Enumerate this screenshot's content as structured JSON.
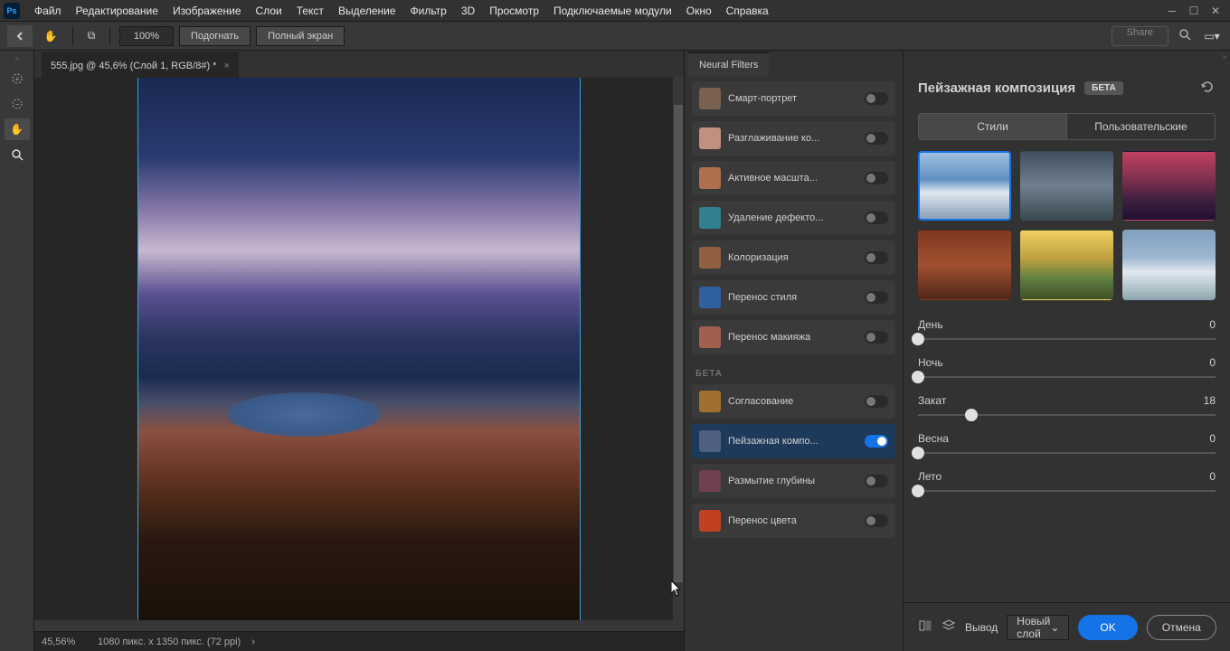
{
  "app": {
    "logo": "Ps"
  },
  "menu": {
    "items": [
      "Файл",
      "Редактирование",
      "Изображение",
      "Слои",
      "Текст",
      "Выделение",
      "Фильтр",
      "3D",
      "Просмотр",
      "Подключаемые модули",
      "Окно",
      "Справка"
    ]
  },
  "toolbar": {
    "zoom": "100%",
    "fit": "Подогнать",
    "fullscreen": "Полный экран",
    "share": "Share"
  },
  "document": {
    "tab_title": "555.jpg @ 45,6% (Слой 1, RGB/8#) *"
  },
  "status": {
    "zoom": "45,56%",
    "dimensions": "1080 пикс. x 1350 пикс. (72 ppi)"
  },
  "neural_filters": {
    "title": "Neural Filters",
    "section_beta": "БЕТА",
    "items": [
      {
        "label": "Смарт-портрет",
        "on": false,
        "thumb": "#7a6050"
      },
      {
        "label": "Разглаживание ко...",
        "on": false,
        "thumb": "#c09080"
      },
      {
        "label": "Активное масшта...",
        "on": false,
        "thumb": "#b07050"
      },
      {
        "label": "Удаление дефекто...",
        "on": false,
        "thumb": "#308090"
      },
      {
        "label": "Колоризация",
        "on": false,
        "thumb": "#906040"
      },
      {
        "label": "Перенос стиля",
        "on": false,
        "thumb": "#3060a0"
      },
      {
        "label": "Перенос макияжа",
        "on": false,
        "thumb": "#a06050"
      }
    ],
    "beta_items": [
      {
        "label": "Согласование",
        "on": false,
        "thumb": "#a07030"
      },
      {
        "label": "Пейзажная компо...",
        "on": true,
        "thumb": "#506080"
      },
      {
        "label": "Размытие глубины",
        "on": false,
        "thumb": "#704050"
      },
      {
        "label": "Перенос цвета",
        "on": false,
        "thumb": "#c04020"
      }
    ]
  },
  "right_panel": {
    "title": "Пейзажная композиция",
    "badge": "БЕТА",
    "tabs": {
      "styles": "Стили",
      "custom": "Пользовательские"
    },
    "presets": [
      {
        "selected": true,
        "bg": "linear-gradient(180deg,#a0c0e0 0%,#6090c0 40%,#e0e8f0 60%,#88a0b8 100%)"
      },
      {
        "selected": false,
        "bg": "linear-gradient(180deg,#405060 0%,#708090 50%,#3a4a50 100%)"
      },
      {
        "selected": false,
        "bg": "linear-gradient(180deg,#c04060 0%,#803050 40%,#402040 70%,#201030 100%)"
      },
      {
        "selected": false,
        "bg": "linear-gradient(180deg,#803820 0%,#a05030 50%,#502818 100%)"
      },
      {
        "selected": false,
        "bg": "linear-gradient(180deg,#f0d060 0%,#c0a040 40%,#608040 70%,#405028 100%)"
      },
      {
        "selected": false,
        "bg": "linear-gradient(180deg,#80a0c0 0%,#a0b8d0 40%,#e0e8f0 60%,#90a8b0 100%)"
      }
    ],
    "sliders": [
      {
        "label": "День",
        "value": "0",
        "pos": 0
      },
      {
        "label": "Ночь",
        "value": "0",
        "pos": 0
      },
      {
        "label": "Закат",
        "value": "18",
        "pos": 18
      },
      {
        "label": "Весна",
        "value": "0",
        "pos": 0
      },
      {
        "label": "Лето",
        "value": "0",
        "pos": 0
      }
    ],
    "footer": {
      "output_label": "Вывод",
      "output_value": "Новый слой",
      "ok": "OK",
      "cancel": "Отмена"
    }
  }
}
